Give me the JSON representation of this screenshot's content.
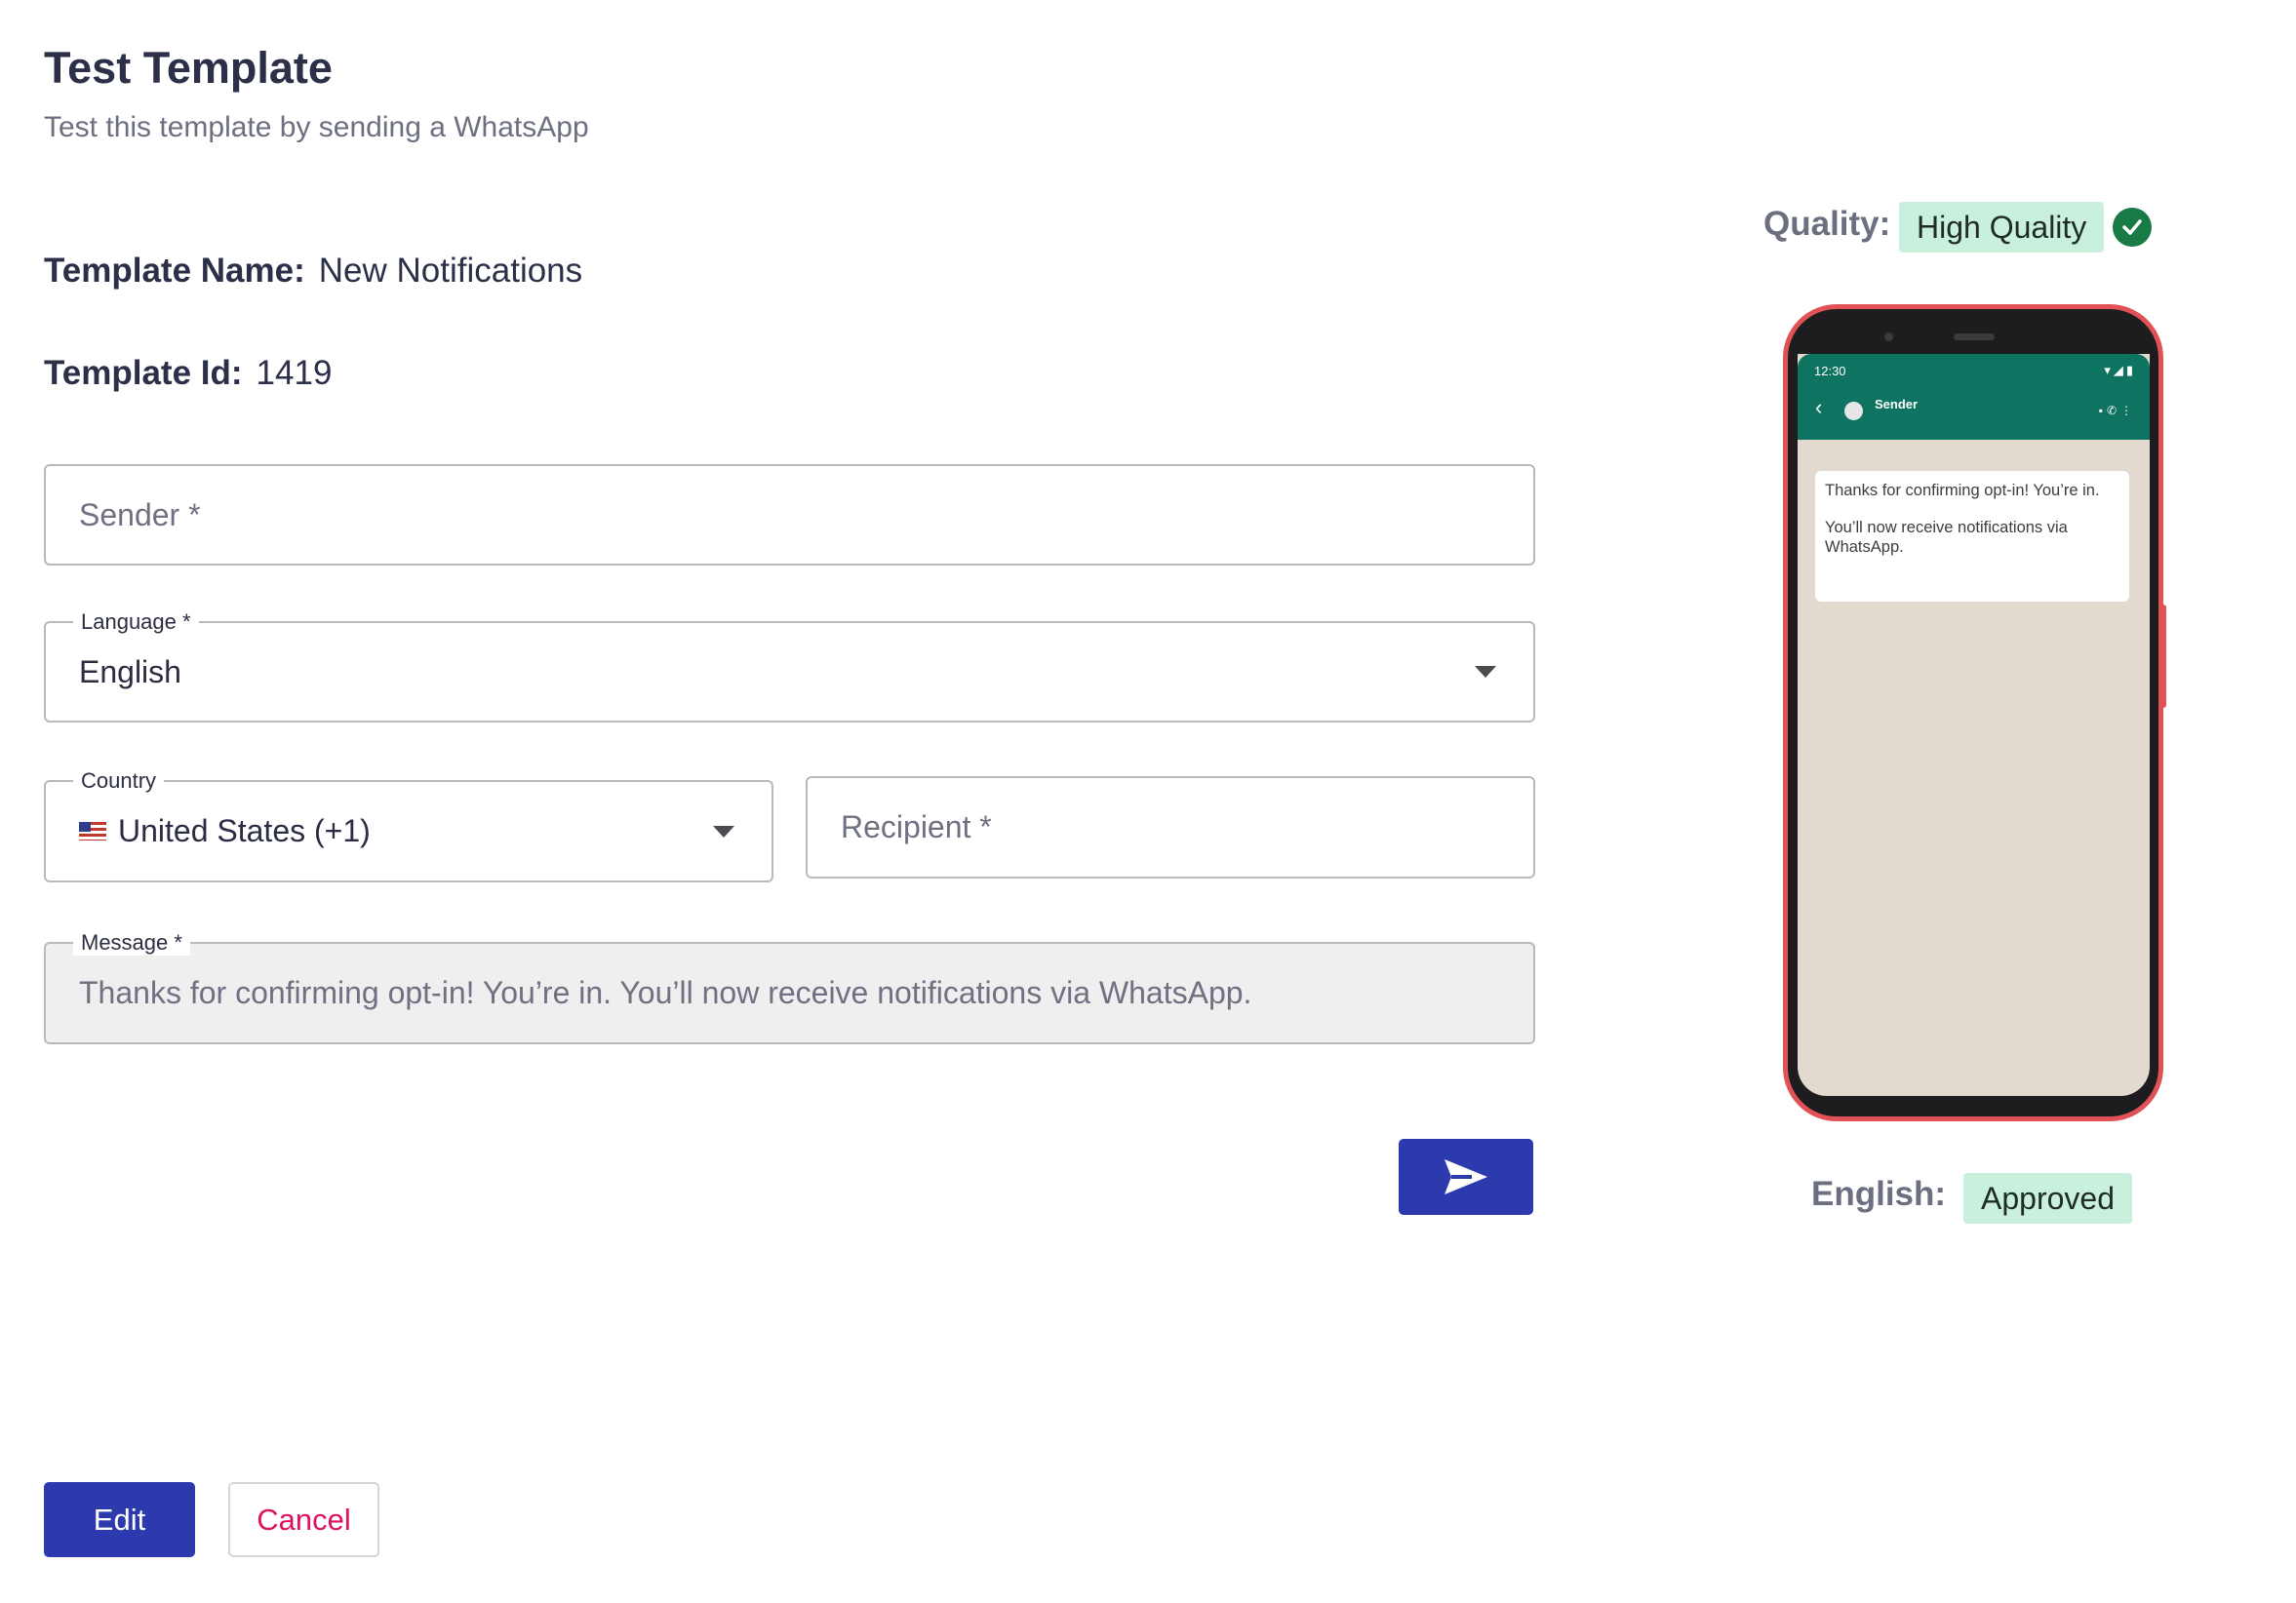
{
  "header": {
    "title": "Test Template",
    "subtitle": "Test this template by sending a WhatsApp"
  },
  "template": {
    "name_label": "Template Name:",
    "name_value": "New Notifications",
    "id_label": "Template Id:",
    "id_value": "1419"
  },
  "form": {
    "sender_placeholder": "Sender *",
    "language_label": "Language *",
    "language_value": "English",
    "country_label": "Country",
    "country_value": "United States (+1)",
    "recipient_placeholder": "Recipient *",
    "message_label": "Message *",
    "message_value": "Thanks for confirming opt-in! You’re in. You’ll now receive notifications via WhatsApp."
  },
  "actions": {
    "edit_label": "Edit",
    "cancel_label": "Cancel"
  },
  "preview": {
    "quality_label": "Quality:",
    "quality_value": "High Quality",
    "language_label": "English:",
    "status_value": "Approved",
    "phone": {
      "time": "12:30",
      "sender": "Sender",
      "message_line1": "Thanks for confirming opt-in!  You’re in.",
      "message_line2": "You’ll now receive  notifications via WhatsApp."
    }
  },
  "colors": {
    "primary": "#2c3aad",
    "danger": "#e0115f",
    "badge_bg": "#c8f0dc",
    "whatsapp_green": "#0e7360",
    "phone_frame": "#e05255"
  }
}
